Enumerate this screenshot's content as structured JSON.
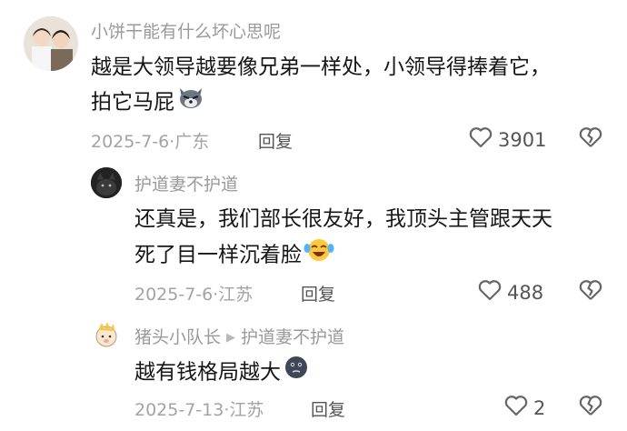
{
  "comments": [
    {
      "username": "小饼干能有什么坏心思呢",
      "text_lines": [
        "越是大领导越要像兄弟一样处，小领导得捧着它，",
        "拍它马屁"
      ],
      "date": "2025-7-6",
      "location": "广东",
      "reply_label": "回复",
      "likes": "3901",
      "emoji": "wolf-face-emoji"
    },
    {
      "username": "护道妻不护道",
      "text_lines": [
        "还真是，我们部长很友好，我顶头主管跟天天",
        "死了目一样沉着脸"
      ],
      "date": "2025-7-6",
      "location": "江苏",
      "reply_label": "回复",
      "likes": "488",
      "emoji": "crying-laughing-emoji"
    },
    {
      "username": "猪头小队长",
      "reply_to": "护道妻不护道",
      "text_lines": [
        "越有钱格局越大"
      ],
      "date": "2025-7-13",
      "location": "江苏",
      "reply_label": "回复",
      "likes": "2",
      "emoji": "dark-face-emoji"
    }
  ],
  "meta_separator": "·",
  "colors": {
    "meta": "#a3a3a3",
    "username": "#9a9a9a",
    "text": "#161616",
    "icon": "#666666"
  }
}
